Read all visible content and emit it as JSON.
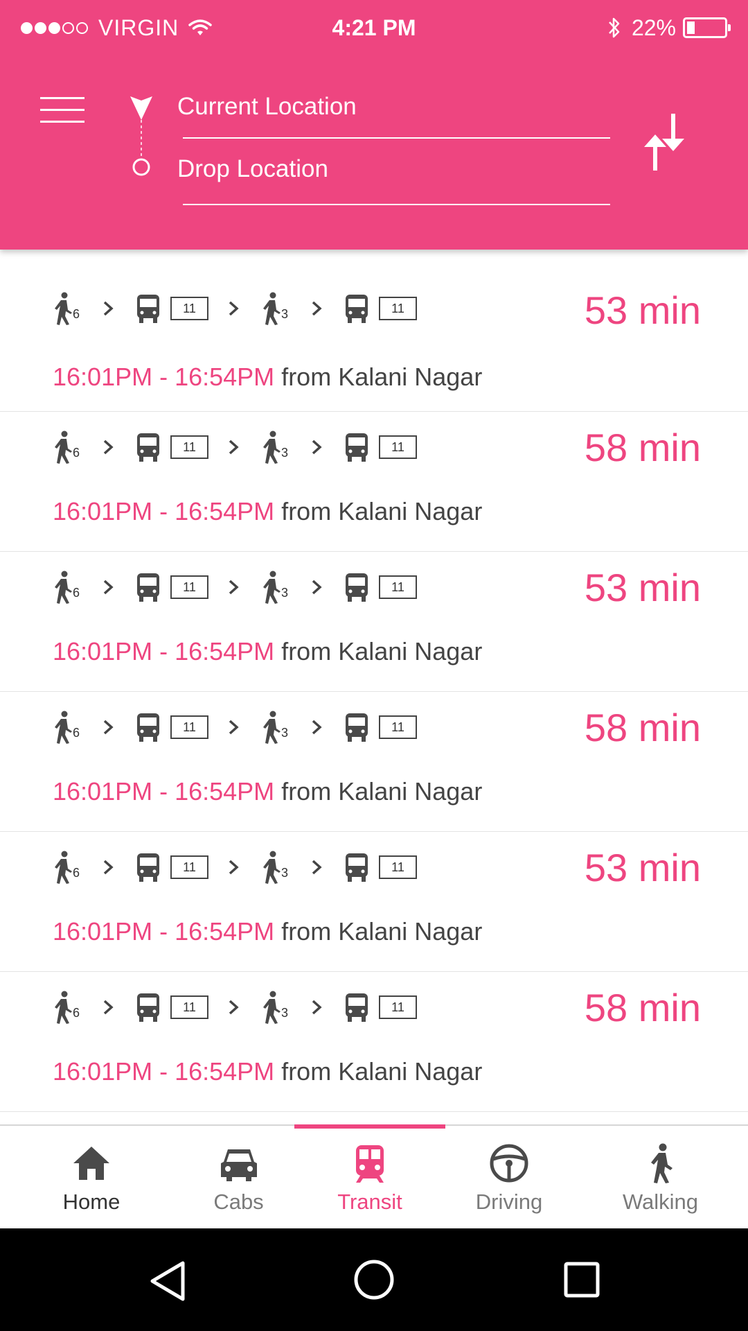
{
  "status_bar": {
    "signal_full": 3,
    "signal_empty": 2,
    "carrier": "VIRGIN",
    "time": "4:21 PM",
    "battery_percent": "22%",
    "battery_level": 0.22
  },
  "header": {
    "menu_icon": "hamburger-menu-icon",
    "current_location": "Current Location",
    "drop_location": "Drop Location",
    "swap_icon": "swap-direction-icon"
  },
  "routes": [
    {
      "walk1": "6",
      "bus1": "11",
      "walk2": "3",
      "bus2": "11",
      "duration": "53 min",
      "time_range": "16:01PM - 16:54PM",
      "from": "from Kalani Nagar"
    },
    {
      "walk1": "6",
      "bus1": "11",
      "walk2": "3",
      "bus2": "11",
      "duration": "58 min",
      "time_range": "16:01PM - 16:54PM",
      "from": "from Kalani Nagar"
    },
    {
      "walk1": "6",
      "bus1": "11",
      "walk2": "3",
      "bus2": "11",
      "duration": "53 min",
      "time_range": "16:01PM - 16:54PM",
      "from": "from Kalani Nagar"
    },
    {
      "walk1": "6",
      "bus1": "11",
      "walk2": "3",
      "bus2": "11",
      "duration": "58 min",
      "time_range": "16:01PM - 16:54PM",
      "from": "from Kalani Nagar"
    },
    {
      "walk1": "6",
      "bus1": "11",
      "walk2": "3",
      "bus2": "11",
      "duration": "53 min",
      "time_range": "16:01PM - 16:54PM",
      "from": "from Kalani Nagar"
    },
    {
      "walk1": "6",
      "bus1": "11",
      "walk2": "3",
      "bus2": "11",
      "duration": "58 min",
      "time_range": "16:01PM - 16:54PM",
      "from": "from Kalani Nagar"
    }
  ],
  "tabs": [
    {
      "label": "Home",
      "icon": "home-icon"
    },
    {
      "label": "Cabs",
      "icon": "car-icon"
    },
    {
      "label": "Transit",
      "icon": "train-icon",
      "active": true
    },
    {
      "label": "Driving",
      "icon": "steering-wheel-icon"
    },
    {
      "label": "Walking",
      "icon": "walking-icon"
    }
  ],
  "colors": {
    "accent": "#ee4580",
    "text_dark": "#444444",
    "icon_gray": "#4a4a4a",
    "nav_bar": "#000000"
  }
}
